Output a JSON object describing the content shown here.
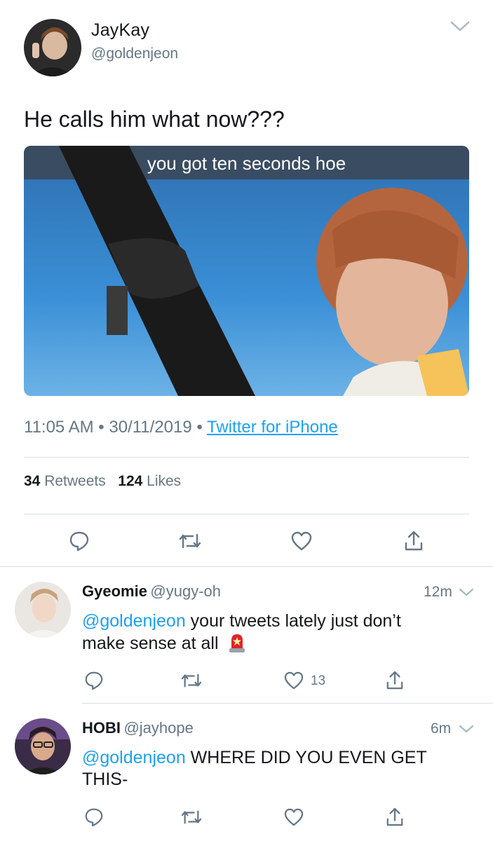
{
  "main_tweet": {
    "display_name": "JayKay",
    "handle": "@goldenjeon",
    "text": "He calls him what now???",
    "media_caption": "you got ten seconds hoe",
    "time": "11:05 AM",
    "date": "30/11/2019",
    "source": "Twitter for iPhone",
    "retweet_count": "34",
    "retweet_label": "Retweets",
    "like_count": "124",
    "like_label": "Likes"
  },
  "replies": [
    {
      "display_name": "Gyeomie",
      "handle": "@yugy-oh",
      "time": "12m",
      "mention": "@goldenjeon",
      "text_line1": " your tweets lately just don’t",
      "text_line2": "make sense at all",
      "emoji": "police-light-emoji",
      "like_count": "13"
    },
    {
      "display_name": "HOBI",
      "handle": "@jayhope",
      "time": "6m",
      "mention": "@goldenjeon",
      "text_line1": " WHERE DID YOU EVEN GET",
      "text_line2": "THIS-",
      "like_count": ""
    }
  ],
  "colors": {
    "link": "#1da1f2",
    "secondary_text": "#657786",
    "primary_text": "#14171a",
    "divider": "#dadfe3"
  },
  "icons": [
    "reply-icon",
    "retweet-icon",
    "like-icon",
    "share-icon",
    "chevron-down-icon"
  ]
}
